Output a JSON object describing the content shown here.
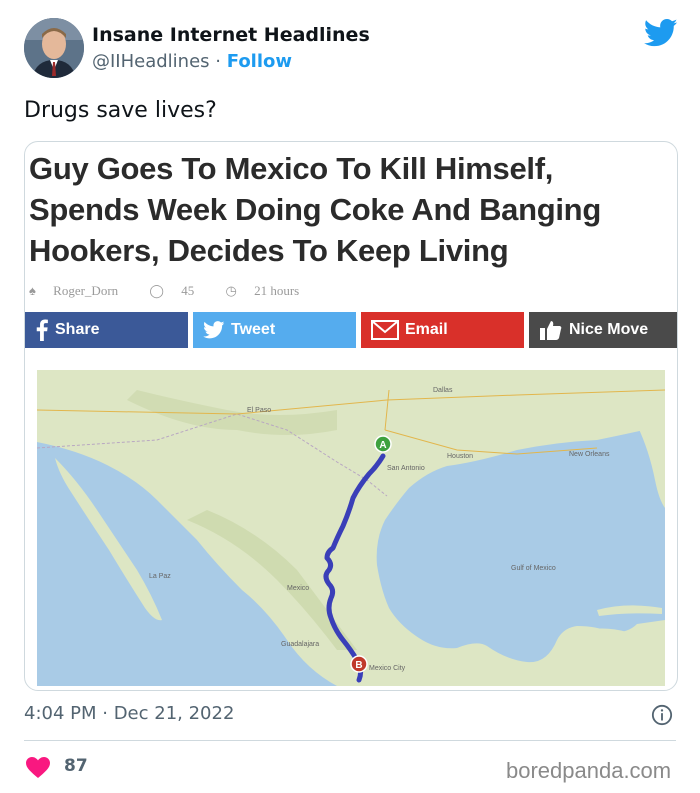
{
  "header": {
    "display_name": "Insane Internet Headlines",
    "handle": "@IIHeadlines",
    "separator": "·",
    "follow_label": "Follow"
  },
  "tweet": {
    "text": "Drugs save lives?",
    "timestamp": "4:04 PM · Dec 21, 2022",
    "likes": "87"
  },
  "article": {
    "headline": "Guy Goes To Mexico To Kill Himself, Spends Week Doing Coke And Banging Hookers, Decides To Keep Living",
    "author": "Roger_Dorn",
    "comments": "45",
    "age": "21 hours",
    "share_buttons": {
      "share": "Share",
      "tweet": "Tweet",
      "email": "Email",
      "nice": "Nice Move"
    }
  },
  "map": {
    "labels": {
      "mexico": "Mexico",
      "el_paso": "El Paso",
      "dallas": "Dallas",
      "san_antonio": "San Antonio",
      "houston": "Houston",
      "guadalajara": "Guadalajara",
      "mexico_city": "Mexico City",
      "gulf": "Gulf of Mexico",
      "la_paz": "La Paz",
      "new_orleans": "New Orleans"
    },
    "start_marker": "A",
    "end_marker": "B"
  },
  "watermark": "boredpanda.com",
  "colors": {
    "twitter_blue": "#1d9bf0",
    "like_red": "#f91880",
    "facebook": "#3b5998",
    "tweet_btn": "#55acee",
    "email_btn": "#d9302a",
    "route": "#3a3fb8"
  }
}
